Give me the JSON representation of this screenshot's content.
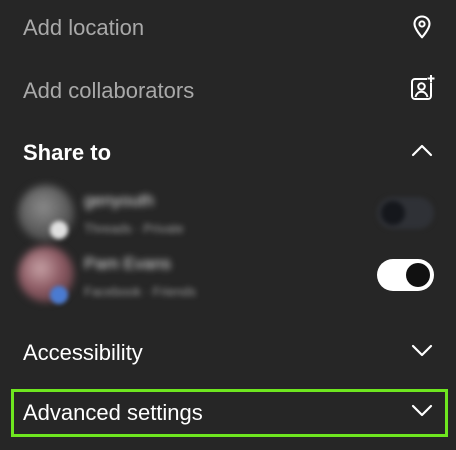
{
  "menu": {
    "add_location": {
      "label": "Add location",
      "icon": "location-pin-icon"
    },
    "add_collaborators": {
      "label": "Add collaborators",
      "icon": "add-person-icon"
    }
  },
  "share_to": {
    "title": "Share to",
    "state": "expanded",
    "accounts": [
      {
        "name": "genyouth",
        "subtitle": "Threads · Private",
        "toggle_on": false
      },
      {
        "name": "Pam Evans",
        "subtitle": "Facebook · Friends",
        "toggle_on": true
      }
    ]
  },
  "accessibility": {
    "label": "Accessibility",
    "state": "collapsed"
  },
  "advanced_settings": {
    "label": "Advanced settings",
    "state": "collapsed",
    "highlighted": true
  },
  "colors": {
    "background": "#262626",
    "muted_text": "#a9a9a9",
    "highlight": "#6ee61f"
  }
}
